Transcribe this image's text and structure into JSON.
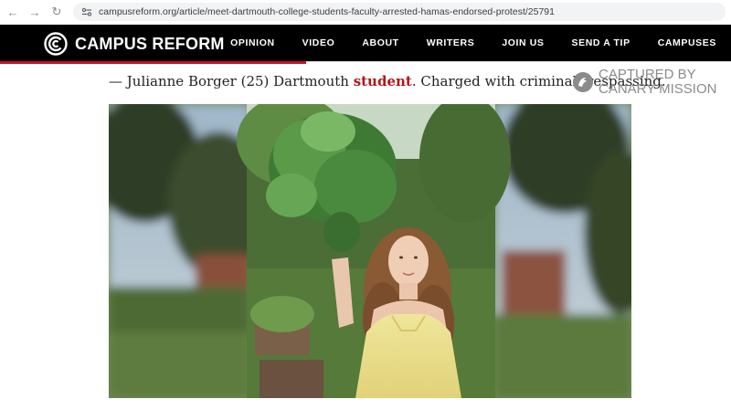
{
  "browser": {
    "url": "campusreform.org/article/meet-dartmouth-college-students-faculty-arrested-hamas-endorsed-protest/25791"
  },
  "header": {
    "logo_text": "CAMPUS REFORM",
    "nav": [
      "OPINION",
      "VIDEO",
      "ABOUT",
      "WRITERS",
      "JOIN US",
      "SEND A TIP",
      "CAMPUSES"
    ]
  },
  "caption": {
    "prefix": "— Julianne Borger (25) Dartmouth ",
    "highlight": "student",
    "suffix": ". Charged with criminal trespassing."
  },
  "watermark": {
    "line1": "CAPTURED BY",
    "line2": "CANARY MISSION"
  },
  "colors": {
    "header_bg": "#000000",
    "accent_red": "#c8102e",
    "link_red": "#b11818",
    "watermark_gray": "#8b8b8b"
  },
  "photo": {
    "description_icon": "person-holding-kale-photo"
  }
}
